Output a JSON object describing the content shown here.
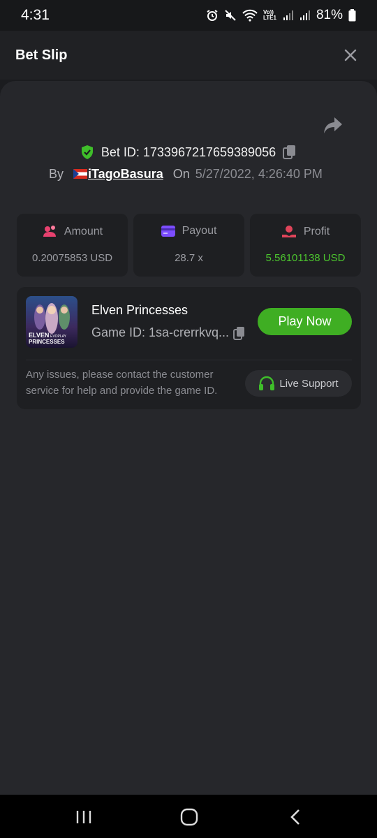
{
  "status_bar": {
    "time": "4:31",
    "battery": "81%",
    "icons": [
      "alarm-icon",
      "mute-icon",
      "wifi-icon",
      "volte-icon",
      "signal-icon",
      "signal-icon",
      "battery-icon"
    ],
    "volte_label": "Vo)) LTE1"
  },
  "header": {
    "title": "Bet Slip",
    "close_icon": "close-icon"
  },
  "bet": {
    "id_text": "Bet ID: 1733967217659389056",
    "by_label": "By",
    "user": "iTagoBasura",
    "on_label": "On",
    "date": "5/27/2022, 4:26:40 PM"
  },
  "stats": {
    "amount": {
      "label": "Amount",
      "value": "0.20075853 USD",
      "icon": "amount-icon"
    },
    "payout": {
      "label": "Payout",
      "value": "28.7 x",
      "icon": "card-icon"
    },
    "profit": {
      "label": "Profit",
      "value": "5.56101138 USD",
      "icon": "profit-icon"
    }
  },
  "game": {
    "title": "Elven Princesses",
    "id_text": "Game ID: 1sa-crerrkvq...",
    "play_label": "Play Now",
    "thumb_title_1": "ELVEN",
    "thumb_title_2": "PRINCESSES",
    "thumb_brand": "EVOPLAY"
  },
  "support": {
    "message": "Any issues, please contact the customer service for help and provide the game ID.",
    "button_label": "Live Support"
  },
  "colors": {
    "accent_green": "#3fae23",
    "profit_green": "#4cc52e",
    "amount_pink": "#e8416f",
    "payout_purple": "#7c4dff",
    "profit_red": "#e0445a"
  }
}
